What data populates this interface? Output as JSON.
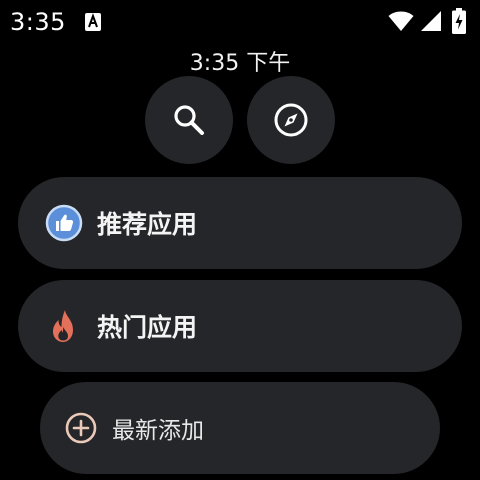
{
  "status_bar": {
    "time": "3:35",
    "notification_icon": "a-box-icon",
    "wifi_icon": "wifi-icon",
    "signal_icon": "signal-icon",
    "battery_icon": "battery-charging-icon"
  },
  "clock": {
    "text": "3:35 下午"
  },
  "quick_actions": [
    {
      "icon": "search-icon"
    },
    {
      "icon": "compass-icon"
    }
  ],
  "menu": {
    "recommended": {
      "label": "推荐应用",
      "icon": "thumbs-up-icon",
      "icon_color": "#5b8fd9"
    },
    "hot": {
      "label": "热门应用",
      "icon": "flame-icon",
      "icon_color": "#e2705a"
    },
    "newest": {
      "label": "最新添加",
      "icon": "add-circle-icon",
      "icon_color": "#e9c9b8"
    }
  },
  "colors": {
    "background": "#000000",
    "surface": "#25262a",
    "text": "#f4f4f4"
  }
}
